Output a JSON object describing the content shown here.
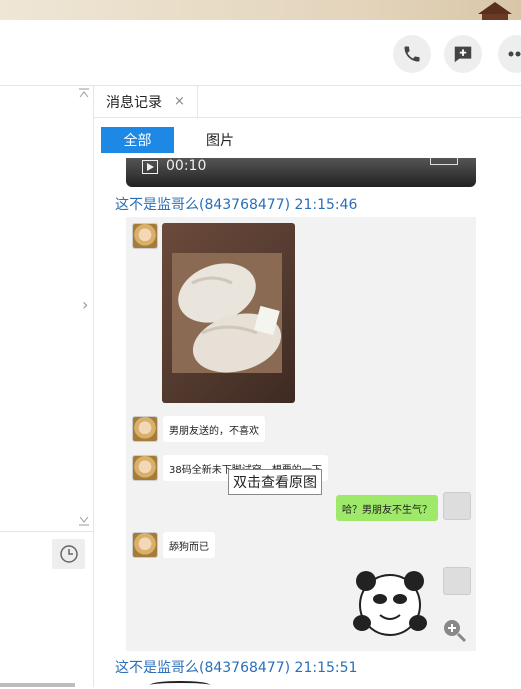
{
  "tabs": [
    {
      "label": "消息记录",
      "close": "×"
    }
  ],
  "filters": {
    "all": "全部",
    "images": "图片"
  },
  "video": {
    "duration": "00:10"
  },
  "messages": [
    {
      "sender": "这不是监哥么(843768477)",
      "time": "21:15:46"
    },
    {
      "sender": "这不是监哥么(843768477)",
      "time": "21:15:51"
    }
  ],
  "screenshot_chat": {
    "bubbles": [
      {
        "text": "男朋友送的，不喜欢"
      },
      {
        "text": "38码全新未下脚试穿，想要的一下"
      },
      {
        "text": "哈？男朋友不生气？"
      },
      {
        "text": "舔狗而已"
      }
    ]
  },
  "tooltip": "双击查看原图",
  "icons": {
    "phone": "phone-icon",
    "add_chat": "chat-plus-icon",
    "more": "more-dots-icon",
    "clock": "clock-icon",
    "zoom": "zoom-in-icon",
    "play": "play-icon"
  },
  "colors": {
    "accent": "#1e88e5",
    "sender": "#2a6fb8",
    "green_bubble": "#9ee86a"
  }
}
